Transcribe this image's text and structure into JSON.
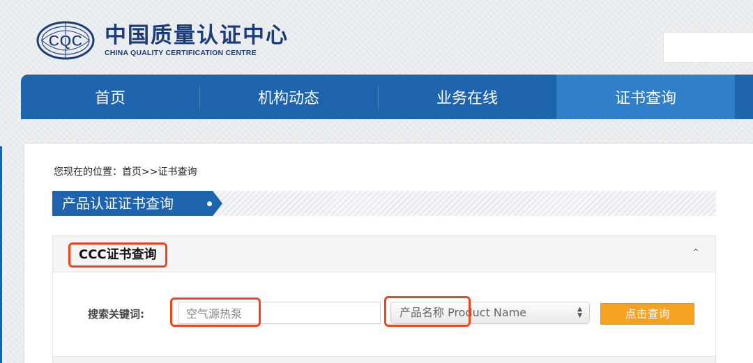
{
  "header": {
    "logo_emblem_text": "CQC",
    "logo_cn": "中国质量认证中心",
    "logo_en": "CHINA QUALITY CERTIFICATION CENTRE",
    "search_value": ""
  },
  "nav": {
    "items": [
      {
        "label": "首页",
        "active": false
      },
      {
        "label": "机构动态",
        "active": false
      },
      {
        "label": "业务在线",
        "active": false
      },
      {
        "label": "证书查询",
        "active": true
      }
    ]
  },
  "breadcrumb": "您现在的位置：首页>>证书查询",
  "section_title": "产品认证证书查询",
  "query": {
    "title": "CCC证书查询",
    "keyword_label": "搜索关键词:",
    "keyword_value": "空气源热泵",
    "select_value": "产品名称 Product Name",
    "button_label": "点击查询"
  },
  "colors": {
    "nav_bg": "#1d64ad",
    "nav_active": "#2f80c9",
    "highlight": "#e9471f",
    "button": "#f5a223"
  }
}
